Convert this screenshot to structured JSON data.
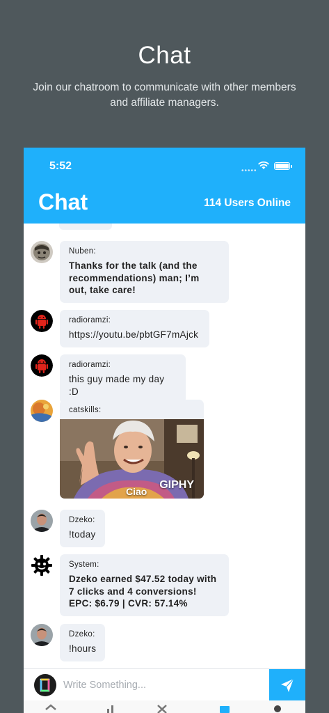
{
  "promo": {
    "title": "Chat",
    "subtitle": "Join our chatroom to communicate with other members and affiliate managers."
  },
  "status_bar": {
    "time": "5:52"
  },
  "header": {
    "title": "Chat",
    "online": "114 Users Online"
  },
  "messages": [
    {
      "user": "Nuben:",
      "text": "Thanks for the talk (and the recommendations) man; I’m  out, take care!",
      "bold": true
    },
    {
      "user": "radioramzi:",
      "text": "https://youtu.be/pbtGF7mAjck",
      "bold": false
    },
    {
      "user": "radioramzi:",
      "text": "this guy made my day :D",
      "bold": false
    },
    {
      "user": "catskills:",
      "gif_caption": "Ciao",
      "gif_brand": "GIPHY"
    },
    {
      "user": "Dzeko:",
      "text": "!today",
      "bold": false
    },
    {
      "user": "System:",
      "text": "Dzeko earned $47.52 today with 7 clicks and 4 conversions!  EPC: $6.79 | CVR: 57.14%",
      "bold": true
    },
    {
      "user": "Dzeko:",
      "text": "!hours",
      "bold": false
    }
  ],
  "composer": {
    "placeholder": "Write Something..."
  },
  "colors": {
    "accent": "#1fb0fb",
    "background": "#4f585c",
    "bubble": "#eef1f6"
  },
  "icons": [
    "wifi-icon",
    "battery-icon",
    "send-icon",
    "home-icon",
    "chart-icon",
    "tools-icon",
    "chat-icon",
    "profile-icon"
  ]
}
